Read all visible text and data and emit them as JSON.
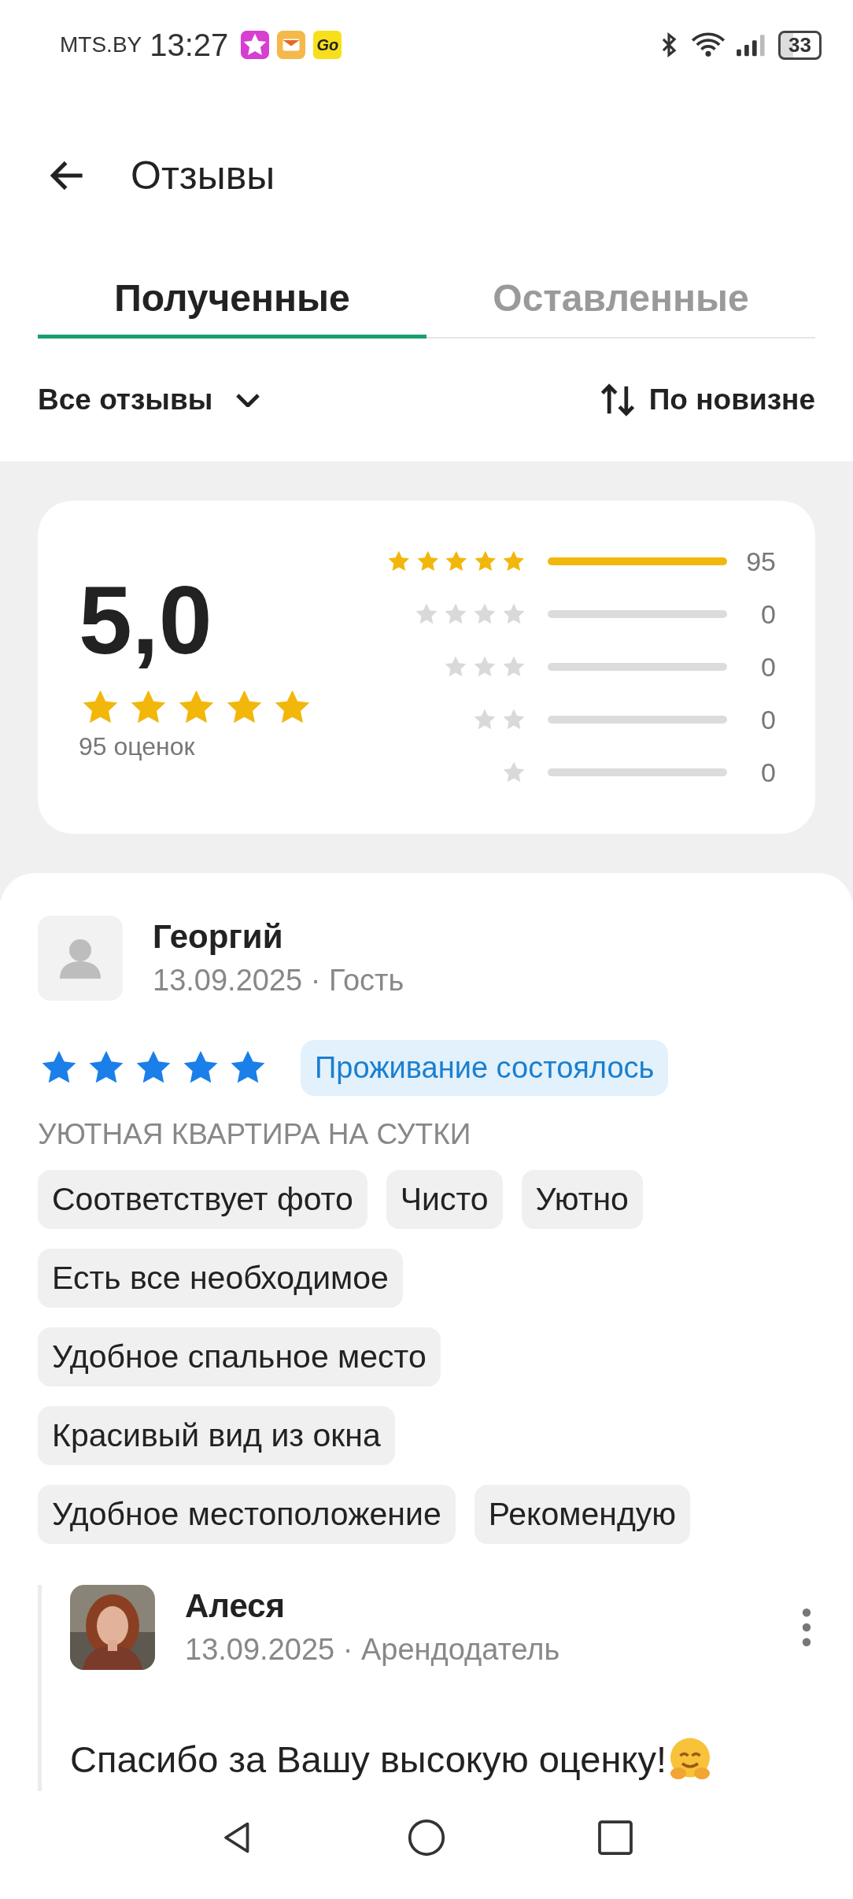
{
  "status_bar": {
    "carrier": "MTS.BY",
    "time": "13:27",
    "app_badge": "Go",
    "battery": "33"
  },
  "header": {
    "title": "Отзывы"
  },
  "tabs": [
    {
      "label": "Полученные",
      "selected": true
    },
    {
      "label": "Оставленные",
      "selected": false
    }
  ],
  "filters": {
    "filter": "Все отзывы",
    "sort": "По новизне"
  },
  "summary": {
    "score": "5,0",
    "stars": 5,
    "count_label": "95 оценок",
    "distribution": [
      {
        "kind": "filled",
        "count": "95"
      },
      {
        "kind": "empty",
        "count": "0"
      },
      {
        "kind": "empty",
        "count": "0"
      },
      {
        "kind": "empty",
        "count": "0"
      },
      {
        "kind": "empty",
        "count": "0"
      }
    ]
  },
  "review": {
    "author": "Георгий",
    "meta": "13.09.2025 · Гость",
    "stars": 5,
    "status": "Проживание состоялось",
    "listing": "УЮТНАЯ КВАРТИРА НА СУТКИ",
    "tags": [
      "Соответствует фото",
      "Чисто",
      "Уютно",
      "Есть все необходимое",
      "Удобное спальное место",
      "Красивый вид из окна",
      "Удобное местоположение",
      "Рекомендую"
    ],
    "reply": {
      "author": "Алеся",
      "meta": "13.09.2025 · Арендодатель",
      "text": "Спасибо за Вашу высокую оценку!"
    }
  }
}
